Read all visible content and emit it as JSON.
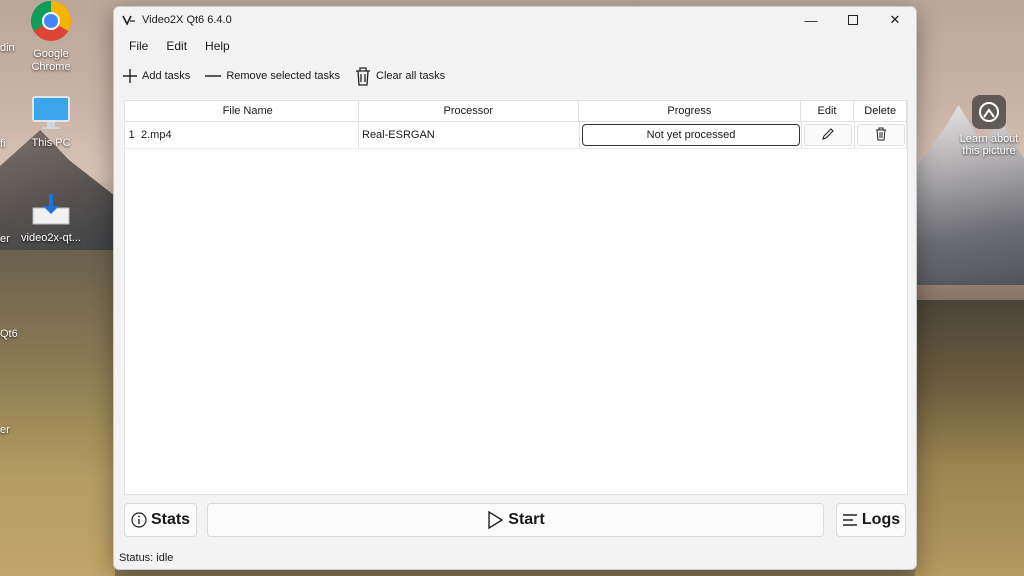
{
  "desktop": {
    "icons": [
      {
        "label": "Google\nChrome"
      },
      {
        "label": "This PC"
      },
      {
        "label": "video2x-qt..."
      }
    ],
    "edge_labels": [
      "din",
      "fi",
      "er",
      "Qt6",
      "er"
    ],
    "spotlight": {
      "label": "Learn about\nthis picture"
    }
  },
  "window": {
    "title": "Video2X Qt6 6.4.0",
    "menu": [
      "File",
      "Edit",
      "Help"
    ],
    "toolbar": {
      "add_tasks": "Add tasks",
      "remove_selected": "Remove selected tasks",
      "clear_all": "Clear all tasks"
    },
    "table": {
      "headers": {
        "file": "File Name",
        "processor": "Processor",
        "progress": "Progress",
        "edit": "Edit",
        "delete": "Delete"
      },
      "rows": [
        {
          "index": "1",
          "file": "2.mp4",
          "processor": "Real-ESRGAN",
          "progress": "Not yet processed"
        }
      ]
    },
    "buttons": {
      "stats": "Stats",
      "start": "Start",
      "logs": "Logs"
    },
    "status": "Status: idle"
  }
}
